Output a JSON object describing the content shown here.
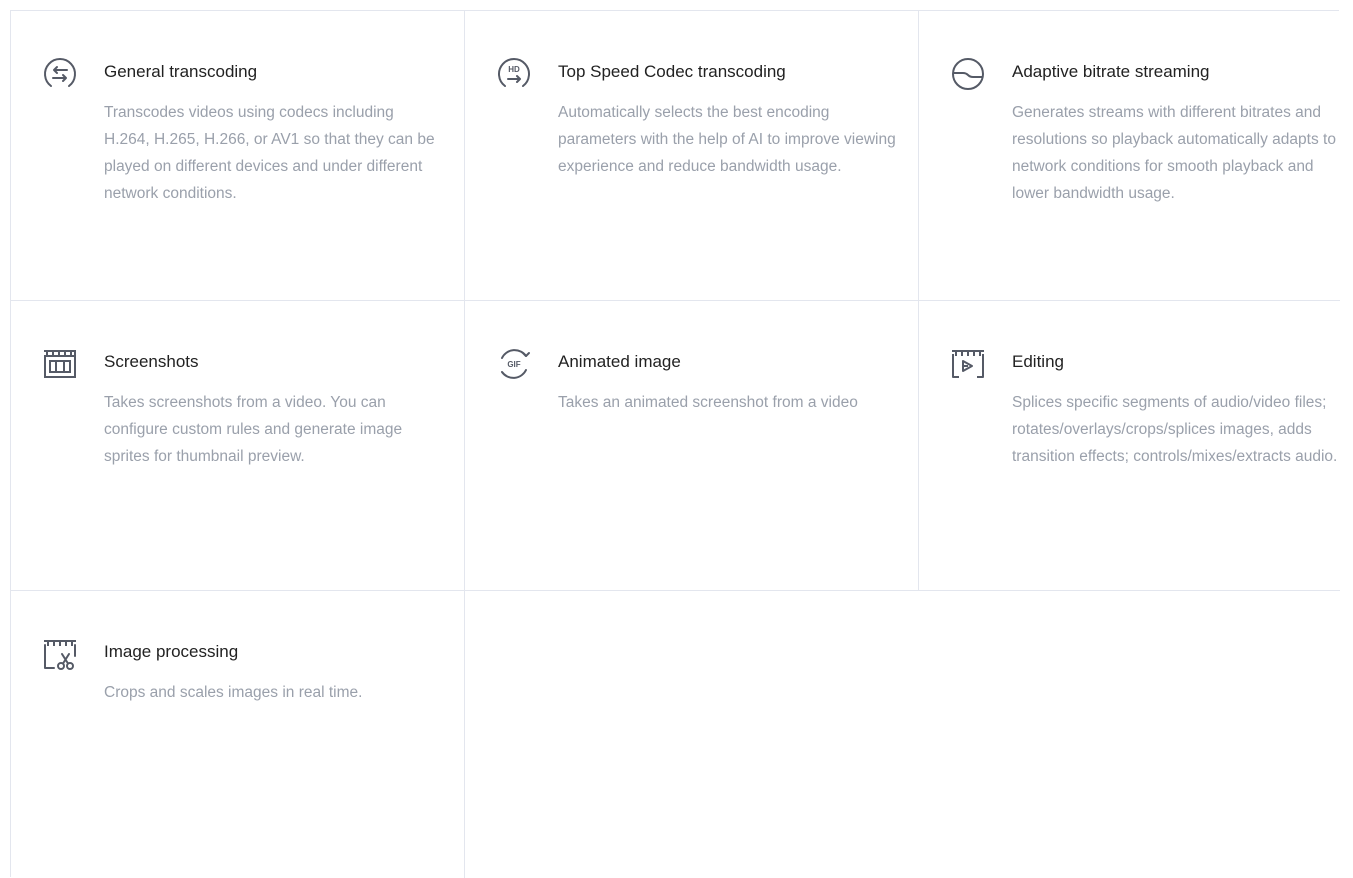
{
  "features": [
    {
      "icon": "transcode-arrows-icon",
      "title": "General transcoding",
      "description": "Transcodes videos using codecs including H.264, H.265, H.266, or AV1 so that they can be played on different devices and under different network conditions."
    },
    {
      "icon": "hd-transcode-icon",
      "title": "Top Speed Codec transcoding",
      "description": "Automatically selects the best encoding parameters with the help of AI to improve viewing experience and reduce bandwidth usage."
    },
    {
      "icon": "adaptive-bitrate-icon",
      "title": "Adaptive bitrate streaming",
      "description": "Generates streams with different bitrates and resolutions so playback automatically adapts to network conditions for smooth playback and lower bandwidth usage."
    },
    {
      "icon": "screenshot-clapper-icon",
      "title": "Screenshots",
      "description": "Takes screenshots from a video. You can configure custom rules and generate image sprites for thumbnail preview."
    },
    {
      "icon": "gif-icon",
      "title": "Animated image",
      "description": "Takes an animated screenshot from a video"
    },
    {
      "icon": "editing-clapper-icon",
      "title": "Editing",
      "description": "Splices specific segments of audio/video files; rotates/overlays/crops/splices images, adds transition effects; controls/mixes/extracts audio."
    },
    {
      "icon": "image-processing-scissors-icon",
      "title": "Image processing",
      "description": "Crops and scales images in real time."
    }
  ]
}
